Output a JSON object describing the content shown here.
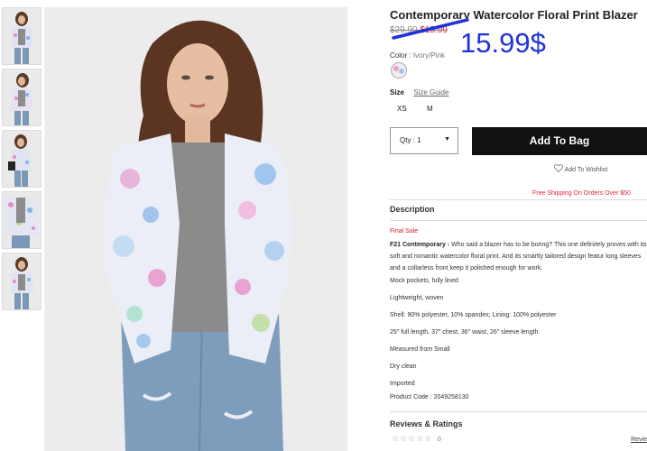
{
  "product": {
    "title": "Contemporary Watercolor Floral Print Blazer",
    "original_price": "$29.90",
    "sale_price": "$15.99",
    "handwritten_price": "15.99$",
    "handwritten_color": "#1f33d8",
    "color_label": "Color :",
    "color_value": "Ivory/Pink",
    "size_label": "Size",
    "size_guide": "Size Guide",
    "sizes": [
      "XS",
      "M"
    ],
    "qty_label": "Qty : 1",
    "add_to_bag": "Add To Bag",
    "add_to_wishlist": "Add To Wishlist",
    "shipping_note": "Free Shipping On Orders Over $50",
    "sale_color": "#d0202a"
  },
  "description": {
    "heading": "Description",
    "final_sale": "Final Sale",
    "brand": "F21 Contemporary -",
    "paragraph": "Who said a blazer has to be boring? This one definitely proves with its soft and romantic watercolor floral print. And its smartly tailored design featur long sleeves and a collarless front keep it polished enough for work.",
    "bullets": [
      "Mock pockets, fully lined",
      "Lightweight, woven",
      "Shell: 90% polyester, 10% spandex; Lining: 100% polyester",
      "25\" full length, 37\" chest, 36\" waist, 26\" sleeve length",
      "Measured from Small",
      "Dry clean",
      "Imported",
      "Product Code : 2049258130"
    ]
  },
  "reviews": {
    "heading": "Reviews & Ratings",
    "stars": "☆☆☆☆☆",
    "count": "0",
    "link": "Revie"
  },
  "icons": {
    "heart": "heart-icon",
    "caret": "caret-down-icon",
    "star": "star-icon"
  }
}
